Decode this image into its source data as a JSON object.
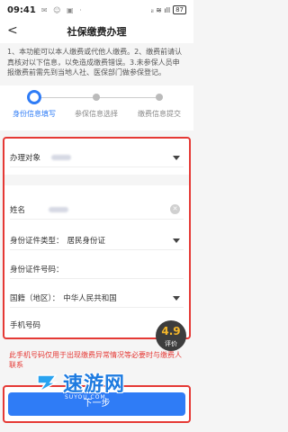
{
  "status_bar": {
    "time": "09:41",
    "icons": "✉ ☺ ▣ ·",
    "signal": "ᵢₗ ≋ ıll",
    "battery": "87"
  },
  "header": {
    "back_glyph": "<",
    "title": "社保缴费办理"
  },
  "notice": "1、本功能可以本人缴费或代他人缴费。2、缴费前请认真核对以下信息，以免造成缴费错误。3.未参保人员申报缴费前需先到当地人社、医保部门做参保登记。",
  "steps": [
    {
      "label": "身份信息填写",
      "active": true
    },
    {
      "label": "参保信息选择",
      "active": false
    },
    {
      "label": "缴费信息提交",
      "active": false
    }
  ],
  "form": {
    "handle_target_label": "办理对象",
    "name_label": "姓名",
    "id_type_label": "身份证件类型：",
    "id_type_value": "居民身份证",
    "id_number_label": "身份证件号码：",
    "nationality_label": "国籍（地区）：",
    "nationality_value": "中华人民共和国",
    "phone_label": "手机号码"
  },
  "rating": {
    "score": "4.9",
    "label": "评价"
  },
  "warning": "此手机号码仅用于出现缴费异常情况等必要时与缴费人联系",
  "next_button": "下一步",
  "watermark": {
    "text": "速游网",
    "url": "SUYOU.COM"
  },
  "colors": {
    "accent": "#2f7cf6",
    "highlight_border": "#e53935"
  }
}
